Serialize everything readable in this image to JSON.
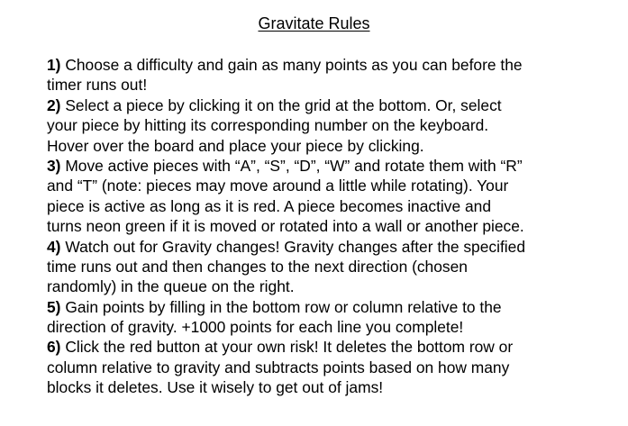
{
  "title": "Gravitate Rules",
  "rules": [
    {
      "number": "1)",
      "lines": [
        "Choose a difficulty and gain as many points as you can before the",
        "timer runs out!"
      ]
    },
    {
      "number": "2)",
      "lines": [
        "Select a piece by clicking it on the grid at the bottom. Or, select",
        "your piece by hitting its corresponding number on the keyboard.",
        "Hover over the board and place your piece by clicking."
      ]
    },
    {
      "number": "3)",
      "lines": [
        "Move active pieces with “A”, “S”, “D”, “W” and rotate them with “R”",
        "and “T” (note: pieces may move around a little while rotating). Your",
        "piece is active as long as it is red. A piece becomes inactive and",
        "turns neon green if it is moved or rotated into a wall or another piece."
      ]
    },
    {
      "number": "4)",
      "lines": [
        "Watch out for Gravity changes! Gravity changes after the specified",
        "time runs out and then changes to the next direction (chosen",
        "randomly) in the queue on the right."
      ]
    },
    {
      "number": "5)",
      "lines": [
        "Gain points by filling in the bottom row or column relative to the",
        "direction of gravity. +1000 points for each line you complete!"
      ]
    },
    {
      "number": "6)",
      "lines": [
        "Click the red button at your own risk! It deletes the bottom row or",
        "column relative to gravity and subtracts points based on how many",
        "blocks it deletes. Use it wisely to get out of jams!"
      ]
    }
  ]
}
